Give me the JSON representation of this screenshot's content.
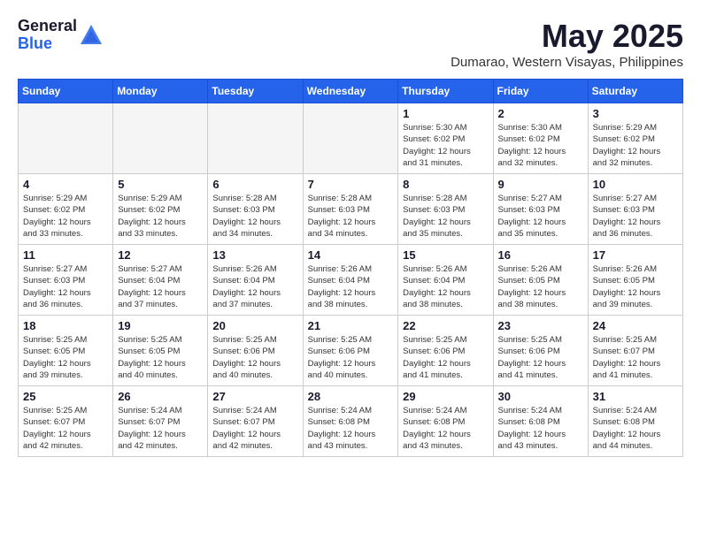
{
  "header": {
    "logo_general": "General",
    "logo_blue": "Blue",
    "month_title": "May 2025",
    "location": "Dumarao, Western Visayas, Philippines"
  },
  "weekdays": [
    "Sunday",
    "Monday",
    "Tuesday",
    "Wednesday",
    "Thursday",
    "Friday",
    "Saturday"
  ],
  "weeks": [
    [
      {
        "day": "",
        "info": ""
      },
      {
        "day": "",
        "info": ""
      },
      {
        "day": "",
        "info": ""
      },
      {
        "day": "",
        "info": ""
      },
      {
        "day": "1",
        "info": "Sunrise: 5:30 AM\nSunset: 6:02 PM\nDaylight: 12 hours\nand 31 minutes."
      },
      {
        "day": "2",
        "info": "Sunrise: 5:30 AM\nSunset: 6:02 PM\nDaylight: 12 hours\nand 32 minutes."
      },
      {
        "day": "3",
        "info": "Sunrise: 5:29 AM\nSunset: 6:02 PM\nDaylight: 12 hours\nand 32 minutes."
      }
    ],
    [
      {
        "day": "4",
        "info": "Sunrise: 5:29 AM\nSunset: 6:02 PM\nDaylight: 12 hours\nand 33 minutes."
      },
      {
        "day": "5",
        "info": "Sunrise: 5:29 AM\nSunset: 6:02 PM\nDaylight: 12 hours\nand 33 minutes."
      },
      {
        "day": "6",
        "info": "Sunrise: 5:28 AM\nSunset: 6:03 PM\nDaylight: 12 hours\nand 34 minutes."
      },
      {
        "day": "7",
        "info": "Sunrise: 5:28 AM\nSunset: 6:03 PM\nDaylight: 12 hours\nand 34 minutes."
      },
      {
        "day": "8",
        "info": "Sunrise: 5:28 AM\nSunset: 6:03 PM\nDaylight: 12 hours\nand 35 minutes."
      },
      {
        "day": "9",
        "info": "Sunrise: 5:27 AM\nSunset: 6:03 PM\nDaylight: 12 hours\nand 35 minutes."
      },
      {
        "day": "10",
        "info": "Sunrise: 5:27 AM\nSunset: 6:03 PM\nDaylight: 12 hours\nand 36 minutes."
      }
    ],
    [
      {
        "day": "11",
        "info": "Sunrise: 5:27 AM\nSunset: 6:03 PM\nDaylight: 12 hours\nand 36 minutes."
      },
      {
        "day": "12",
        "info": "Sunrise: 5:27 AM\nSunset: 6:04 PM\nDaylight: 12 hours\nand 37 minutes."
      },
      {
        "day": "13",
        "info": "Sunrise: 5:26 AM\nSunset: 6:04 PM\nDaylight: 12 hours\nand 37 minutes."
      },
      {
        "day": "14",
        "info": "Sunrise: 5:26 AM\nSunset: 6:04 PM\nDaylight: 12 hours\nand 38 minutes."
      },
      {
        "day": "15",
        "info": "Sunrise: 5:26 AM\nSunset: 6:04 PM\nDaylight: 12 hours\nand 38 minutes."
      },
      {
        "day": "16",
        "info": "Sunrise: 5:26 AM\nSunset: 6:05 PM\nDaylight: 12 hours\nand 38 minutes."
      },
      {
        "day": "17",
        "info": "Sunrise: 5:26 AM\nSunset: 6:05 PM\nDaylight: 12 hours\nand 39 minutes."
      }
    ],
    [
      {
        "day": "18",
        "info": "Sunrise: 5:25 AM\nSunset: 6:05 PM\nDaylight: 12 hours\nand 39 minutes."
      },
      {
        "day": "19",
        "info": "Sunrise: 5:25 AM\nSunset: 6:05 PM\nDaylight: 12 hours\nand 40 minutes."
      },
      {
        "day": "20",
        "info": "Sunrise: 5:25 AM\nSunset: 6:06 PM\nDaylight: 12 hours\nand 40 minutes."
      },
      {
        "day": "21",
        "info": "Sunrise: 5:25 AM\nSunset: 6:06 PM\nDaylight: 12 hours\nand 40 minutes."
      },
      {
        "day": "22",
        "info": "Sunrise: 5:25 AM\nSunset: 6:06 PM\nDaylight: 12 hours\nand 41 minutes."
      },
      {
        "day": "23",
        "info": "Sunrise: 5:25 AM\nSunset: 6:06 PM\nDaylight: 12 hours\nand 41 minutes."
      },
      {
        "day": "24",
        "info": "Sunrise: 5:25 AM\nSunset: 6:07 PM\nDaylight: 12 hours\nand 41 minutes."
      }
    ],
    [
      {
        "day": "25",
        "info": "Sunrise: 5:25 AM\nSunset: 6:07 PM\nDaylight: 12 hours\nand 42 minutes."
      },
      {
        "day": "26",
        "info": "Sunrise: 5:24 AM\nSunset: 6:07 PM\nDaylight: 12 hours\nand 42 minutes."
      },
      {
        "day": "27",
        "info": "Sunrise: 5:24 AM\nSunset: 6:07 PM\nDaylight: 12 hours\nand 42 minutes."
      },
      {
        "day": "28",
        "info": "Sunrise: 5:24 AM\nSunset: 6:08 PM\nDaylight: 12 hours\nand 43 minutes."
      },
      {
        "day": "29",
        "info": "Sunrise: 5:24 AM\nSunset: 6:08 PM\nDaylight: 12 hours\nand 43 minutes."
      },
      {
        "day": "30",
        "info": "Sunrise: 5:24 AM\nSunset: 6:08 PM\nDaylight: 12 hours\nand 43 minutes."
      },
      {
        "day": "31",
        "info": "Sunrise: 5:24 AM\nSunset: 6:08 PM\nDaylight: 12 hours\nand 44 minutes."
      }
    ]
  ]
}
